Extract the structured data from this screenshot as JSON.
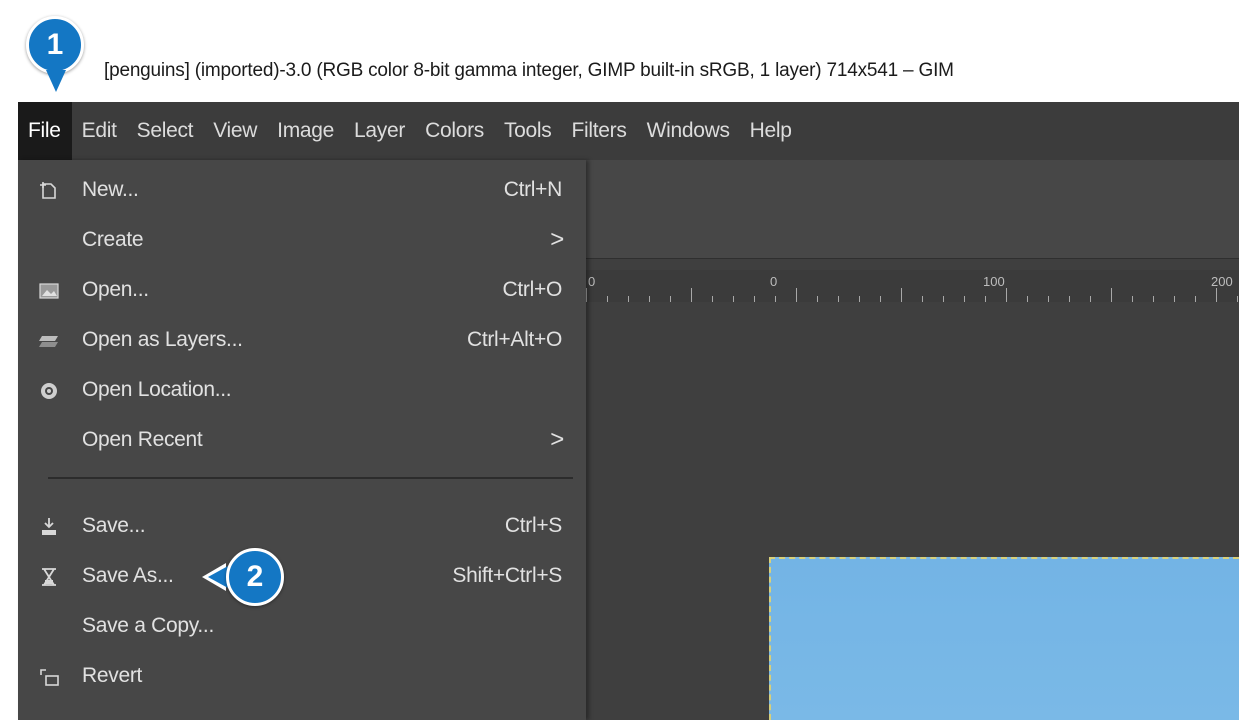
{
  "window": {
    "title": "[penguins] (imported)-3.0 (RGB color 8-bit gamma integer, GIMP built-in sRGB, 1 layer) 714x541 – GIM"
  },
  "menubar": {
    "items": [
      "File",
      "Edit",
      "Select",
      "View",
      "Image",
      "Layer",
      "Colors",
      "Tools",
      "Filters",
      "Windows",
      "Help"
    ],
    "active": "File"
  },
  "file_menu": {
    "items": [
      {
        "label": "New...",
        "shortcut": "Ctrl+N",
        "icon": "new-image-icon"
      },
      {
        "label": "Create",
        "submenu": ">"
      },
      {
        "label": "Open...",
        "shortcut": "Ctrl+O",
        "icon": "open-image-icon"
      },
      {
        "label": "Open as Layers...",
        "shortcut": "Ctrl+Alt+O",
        "icon": "open-layers-icon"
      },
      {
        "label": "Open Location...",
        "icon": "globe-icon"
      },
      {
        "label": "Open Recent",
        "submenu": ">"
      },
      {
        "label": "Save...",
        "shortcut": "Ctrl+S",
        "icon": "save-icon"
      },
      {
        "label": "Save As...",
        "shortcut": "Shift+Ctrl+S",
        "icon": "save-as-icon"
      },
      {
        "label": "Save a Copy..."
      },
      {
        "label": "Revert",
        "icon": "revert-icon"
      }
    ]
  },
  "ruler": {
    "labels": [
      "0",
      "0",
      "100",
      "200"
    ]
  },
  "callouts": [
    {
      "number": "1",
      "target": "File menu"
    },
    {
      "number": "2",
      "target": "Save As..."
    }
  ],
  "colors": {
    "menubar_bg": "#3c3c3c",
    "menu_bg": "#474747",
    "active_menu_bg": "#1a1a1a",
    "badge": "#1477c4",
    "image_sky": "#73b4e5"
  }
}
